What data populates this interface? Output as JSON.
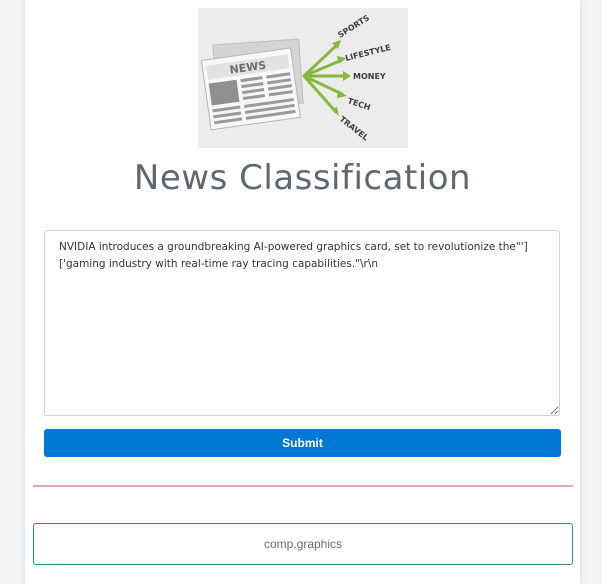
{
  "hero": {
    "newspaper_label": "NEWS",
    "categories": [
      "SPORTS",
      "LIFESTYLE",
      "MONEY",
      "TECH",
      "TRAVEL"
    ],
    "arrow_color": "#86b83d"
  },
  "page": {
    "title": "News Classification"
  },
  "form": {
    "textarea_value": "NVIDIA introduces a groundbreaking AI-powered graphics card, set to revolutionize the\"']\n['gaming industry with real-time ray tracing capabilities.\"\\r\\n",
    "submit_label": "Submit",
    "submit_color": "#0078d4"
  },
  "result": {
    "label": "comp.graphics",
    "border_color": "#2a8c96"
  },
  "divider_color": "#e0a9ae"
}
